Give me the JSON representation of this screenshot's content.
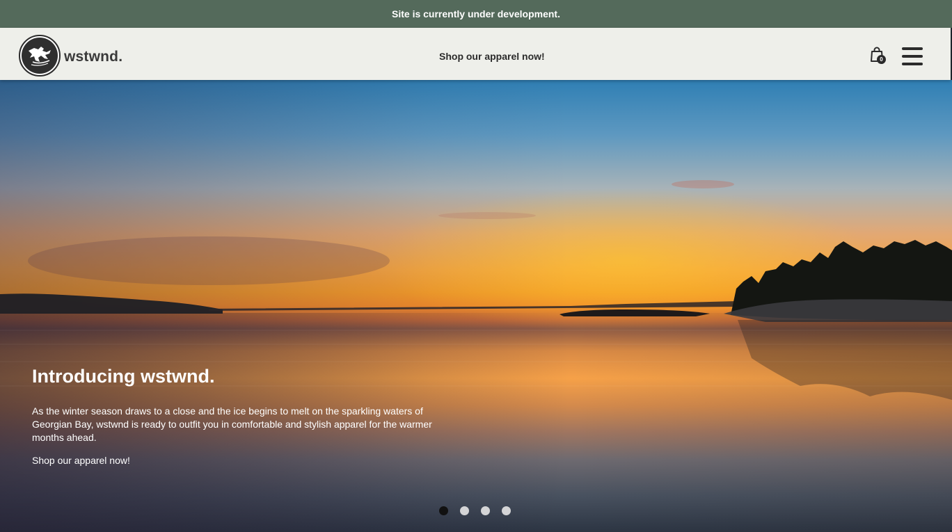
{
  "announcement": {
    "text": "Site is currently under development."
  },
  "header": {
    "brand": "wstwnd.",
    "center_link": "Shop our apparel now!",
    "cart_count": "0",
    "logo_icon": "leaping-figure-logo-icon",
    "cart_icon": "shopping-bag-icon",
    "menu_icon": "hamburger-menu-icon"
  },
  "hero": {
    "title": "Introducing wstwnd.",
    "description": "As the winter season draws to a close and the ice begins to melt on the sparkling waters of Georgian Bay, wstwnd is ready to outfit you in comfortable and stylish apparel for the warmer months ahead.",
    "cta": "Shop our apparel now!",
    "slides": [
      {
        "active": true
      },
      {
        "active": false
      },
      {
        "active": false
      },
      {
        "active": false
      }
    ]
  },
  "colors": {
    "announcement_bg": "#546a5b",
    "header_bg": "#eeefea",
    "text_dark": "#2b2b2b"
  }
}
